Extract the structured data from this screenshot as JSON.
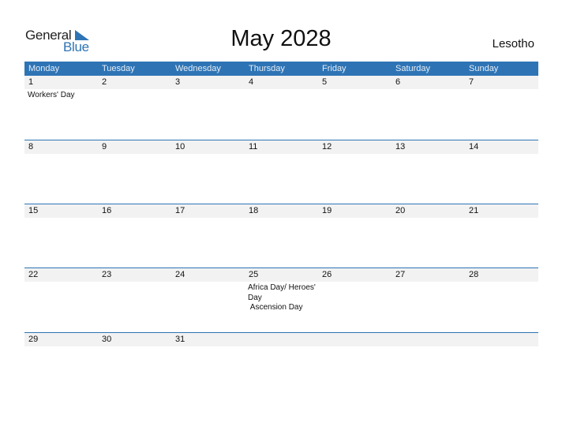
{
  "logo": {
    "word1": "General",
    "word2": "Blue",
    "icon": "triangle-flag-icon"
  },
  "title": "May 2028",
  "country": "Lesotho",
  "colors": {
    "accent": "#2e74b5",
    "strip": "#f2f2f2"
  },
  "weekdays": [
    "Monday",
    "Tuesday",
    "Wednesday",
    "Thursday",
    "Friday",
    "Saturday",
    "Sunday"
  ],
  "weeks": [
    {
      "days": [
        {
          "date": "1",
          "events": [
            "Workers' Day"
          ]
        },
        {
          "date": "2",
          "events": []
        },
        {
          "date": "3",
          "events": []
        },
        {
          "date": "4",
          "events": []
        },
        {
          "date": "5",
          "events": []
        },
        {
          "date": "6",
          "events": []
        },
        {
          "date": "7",
          "events": []
        }
      ]
    },
    {
      "days": [
        {
          "date": "8",
          "events": []
        },
        {
          "date": "9",
          "events": []
        },
        {
          "date": "10",
          "events": []
        },
        {
          "date": "11",
          "events": []
        },
        {
          "date": "12",
          "events": []
        },
        {
          "date": "13",
          "events": []
        },
        {
          "date": "14",
          "events": []
        }
      ]
    },
    {
      "days": [
        {
          "date": "15",
          "events": []
        },
        {
          "date": "16",
          "events": []
        },
        {
          "date": "17",
          "events": []
        },
        {
          "date": "18",
          "events": []
        },
        {
          "date": "19",
          "events": []
        },
        {
          "date": "20",
          "events": []
        },
        {
          "date": "21",
          "events": []
        }
      ]
    },
    {
      "days": [
        {
          "date": "22",
          "events": []
        },
        {
          "date": "23",
          "events": []
        },
        {
          "date": "24",
          "events": []
        },
        {
          "date": "25",
          "events": [
            "Africa Day/ Heroes' Day",
            " Ascension Day"
          ]
        },
        {
          "date": "26",
          "events": []
        },
        {
          "date": "27",
          "events": []
        },
        {
          "date": "28",
          "events": []
        }
      ]
    },
    {
      "days": [
        {
          "date": "29",
          "events": []
        },
        {
          "date": "30",
          "events": []
        },
        {
          "date": "31",
          "events": []
        },
        {
          "date": "",
          "events": []
        },
        {
          "date": "",
          "events": []
        },
        {
          "date": "",
          "events": []
        },
        {
          "date": "",
          "events": []
        }
      ]
    }
  ]
}
